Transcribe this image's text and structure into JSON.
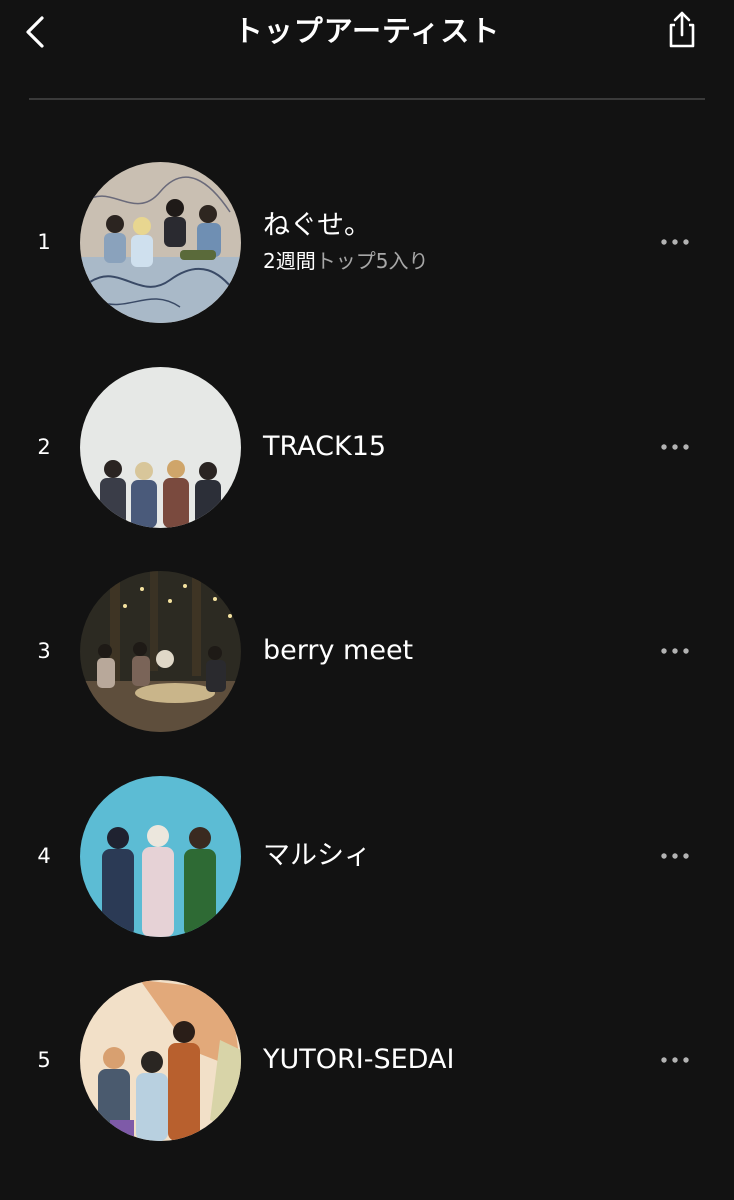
{
  "header": {
    "title": "トップアーティスト",
    "back_icon": "chevron-left-icon",
    "share_icon": "share-icon"
  },
  "artists": [
    {
      "rank": "1",
      "name": "ねぐせ。",
      "meta_highlight": "2週間",
      "meta_rest": "トップ5入り",
      "colors": {
        "bg": "#c9bfb2",
        "floor": "#a9b9c8",
        "accent": "#5a6f8e"
      }
    },
    {
      "rank": "2",
      "name": "TRACK15",
      "meta_highlight": "",
      "meta_rest": "",
      "colors": {
        "bg": "#e6e8e6",
        "floor": "#d2d6d4",
        "accent": "#3a3d48"
      }
    },
    {
      "rank": "3",
      "name": "berry meet",
      "meta_highlight": "",
      "meta_rest": "",
      "colors": {
        "bg": "#2c2a22",
        "floor": "#5e4e3c",
        "accent": "#c9b58a"
      }
    },
    {
      "rank": "4",
      "name": "マルシィ",
      "meta_highlight": "",
      "meta_rest": "",
      "colors": {
        "bg": "#5cbcd4",
        "floor": "#49a8c2",
        "accent": "#2b3a55"
      }
    },
    {
      "rank": "5",
      "name": "YUTORI-SEDAI",
      "meta_highlight": "",
      "meta_rest": "",
      "colors": {
        "bg": "#f2e0c8",
        "floor": "#e2a97a",
        "accent": "#7e5aa8"
      }
    }
  ],
  "more_icon": "more-horizontal-icon",
  "colors": {
    "background": "#121212",
    "text_primary": "#ffffff",
    "text_secondary": "#a7a7a7",
    "divider": "#3a3a3a"
  }
}
